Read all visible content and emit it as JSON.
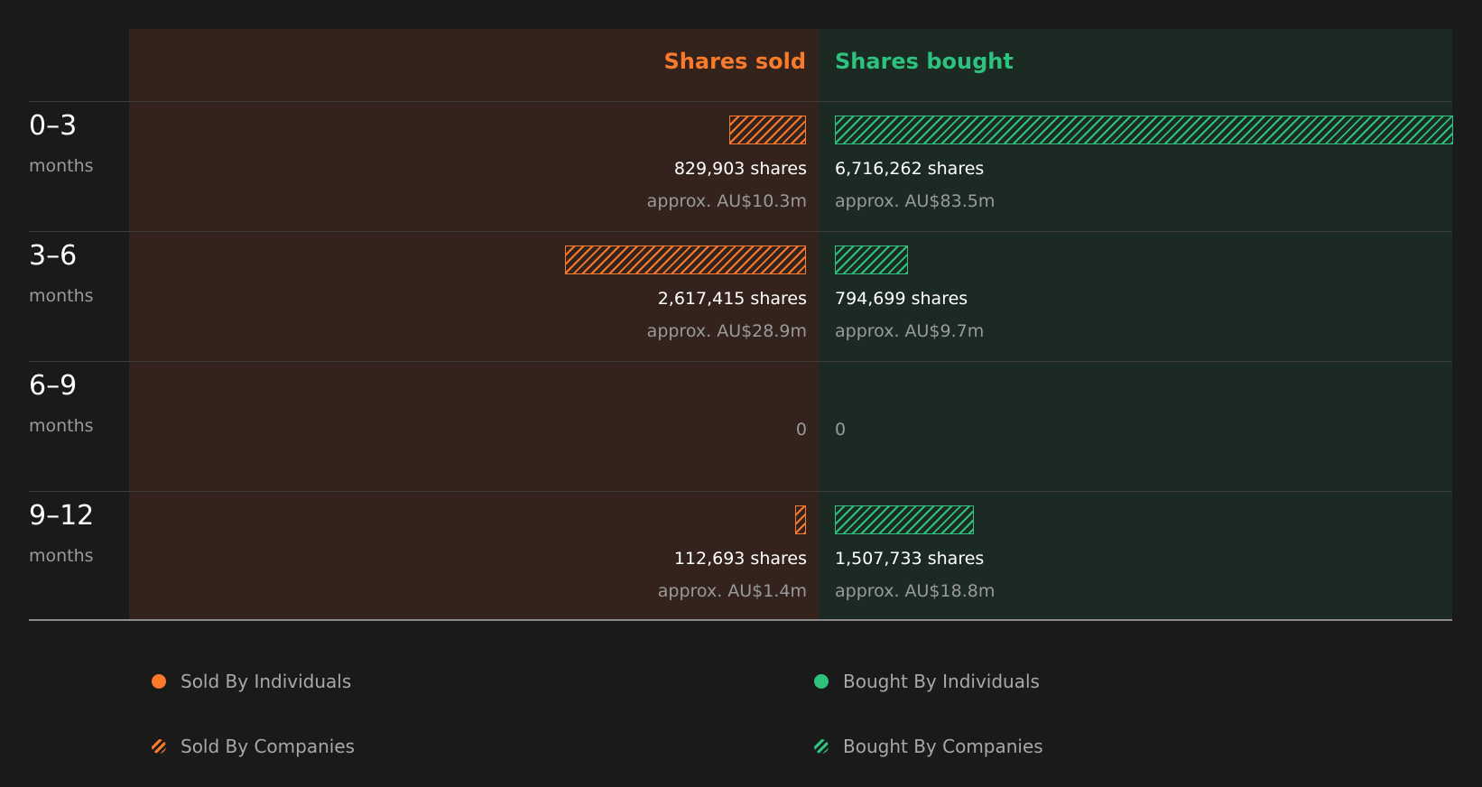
{
  "chart_data": {
    "type": "bar",
    "header": {
      "sold": "Shares sold",
      "bought": "Shares bought"
    },
    "colors": {
      "sold": "#f87a2a",
      "bought": "#2ec27e",
      "sold_bg": "#33231c",
      "bought_bg": "#1c2a24"
    },
    "rows": [
      {
        "period": "0–3",
        "unit": "months",
        "sold": 829903,
        "bought": 6716262,
        "sold_shares": "829,903 shares",
        "sold_approx": "approx. AU$10.3m",
        "bought_shares": "6,716,262 shares",
        "bought_approx": "approx. AU$83.5m"
      },
      {
        "period": "3–6",
        "unit": "months",
        "sold": 2617415,
        "bought": 794699,
        "sold_shares": "2,617,415 shares",
        "sold_approx": "approx. AU$28.9m",
        "bought_shares": "794,699 shares",
        "bought_approx": "approx. AU$9.7m"
      },
      {
        "period": "6–9",
        "unit": "months",
        "sold": 0,
        "bought": 0,
        "sold_zero": "0",
        "bought_zero": "0"
      },
      {
        "period": "9–12",
        "unit": "months",
        "sold": 112693,
        "bought": 1507733,
        "sold_shares": "112,693 shares",
        "sold_approx": "approx. AU$1.4m",
        "bought_shares": "1,507,733 shares",
        "bought_approx": "approx. AU$18.8m"
      }
    ],
    "legend": [
      {
        "label": "Sold By Individuals",
        "color": "#f87a2a",
        "icon": "solid-dot"
      },
      {
        "label": "Bought By Individuals",
        "color": "#2ec27e",
        "icon": "solid-dot"
      },
      {
        "label": "Sold By Companies",
        "color": "#f87a2a",
        "icon": "hatched-dot"
      },
      {
        "label": "Bought By Companies",
        "color": "#2ec27e",
        "icon": "hatched-dot"
      }
    ]
  }
}
